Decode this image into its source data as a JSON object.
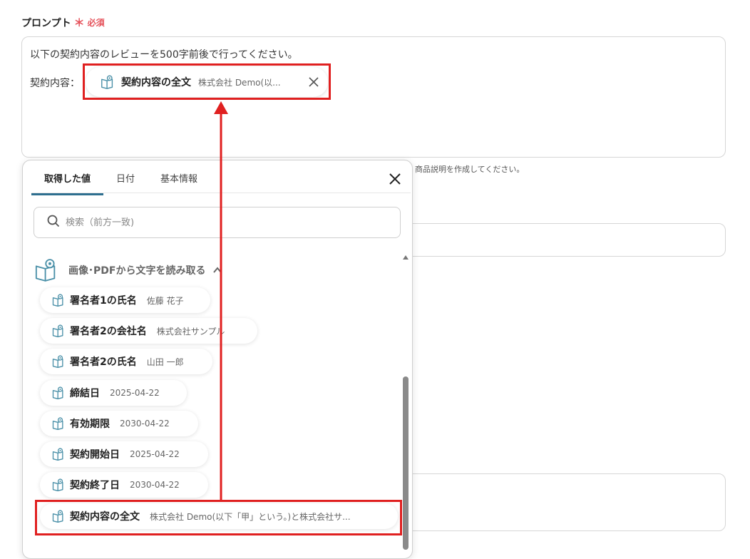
{
  "field": {
    "label": "プロンプト",
    "required_star": "＊",
    "required_text": "必須"
  },
  "prompt": {
    "line1": "以下の契約内容のレビューを500字前後で行ってください。",
    "line2_label": "契約内容：",
    "variable_chip": {
      "name": "契約内容の全文",
      "value": "株式会社 Demo(以...",
      "icon": "book-eye-icon"
    }
  },
  "hint_text": "商品説明を作成してください。",
  "popup": {
    "tabs": [
      {
        "label": "取得した値",
        "active": true
      },
      {
        "label": "日付",
        "active": false
      },
      {
        "label": "基本情報",
        "active": false
      }
    ],
    "search_placeholder": "検索（前方一致)",
    "group": {
      "title": "画像･PDFから文字を読み取る",
      "icon": "book-eye-icon",
      "expanded": true
    },
    "items": [
      {
        "name": "署名者1の氏名",
        "value": "佐藤 花子"
      },
      {
        "name": "署名者2の会社名",
        "value": "株式会社サンプル"
      },
      {
        "name": "署名者2の氏名",
        "value": "山田 一郎"
      },
      {
        "name": "締結日",
        "value": "2025-04-22"
      },
      {
        "name": "有効期限",
        "value": "2030-04-22"
      },
      {
        "name": "契約開始日",
        "value": "2025-04-22"
      },
      {
        "name": "契約終了日",
        "value": "2030-04-22"
      },
      {
        "name": "契約内容の全文",
        "value": "株式会社 Demo(以下「甲」という。)と株式会社サ..."
      }
    ]
  },
  "colors": {
    "highlight": "#e02020",
    "required": "#e5525b",
    "tab_underline": "#2e6f8f",
    "icon": "#4a90a8"
  }
}
